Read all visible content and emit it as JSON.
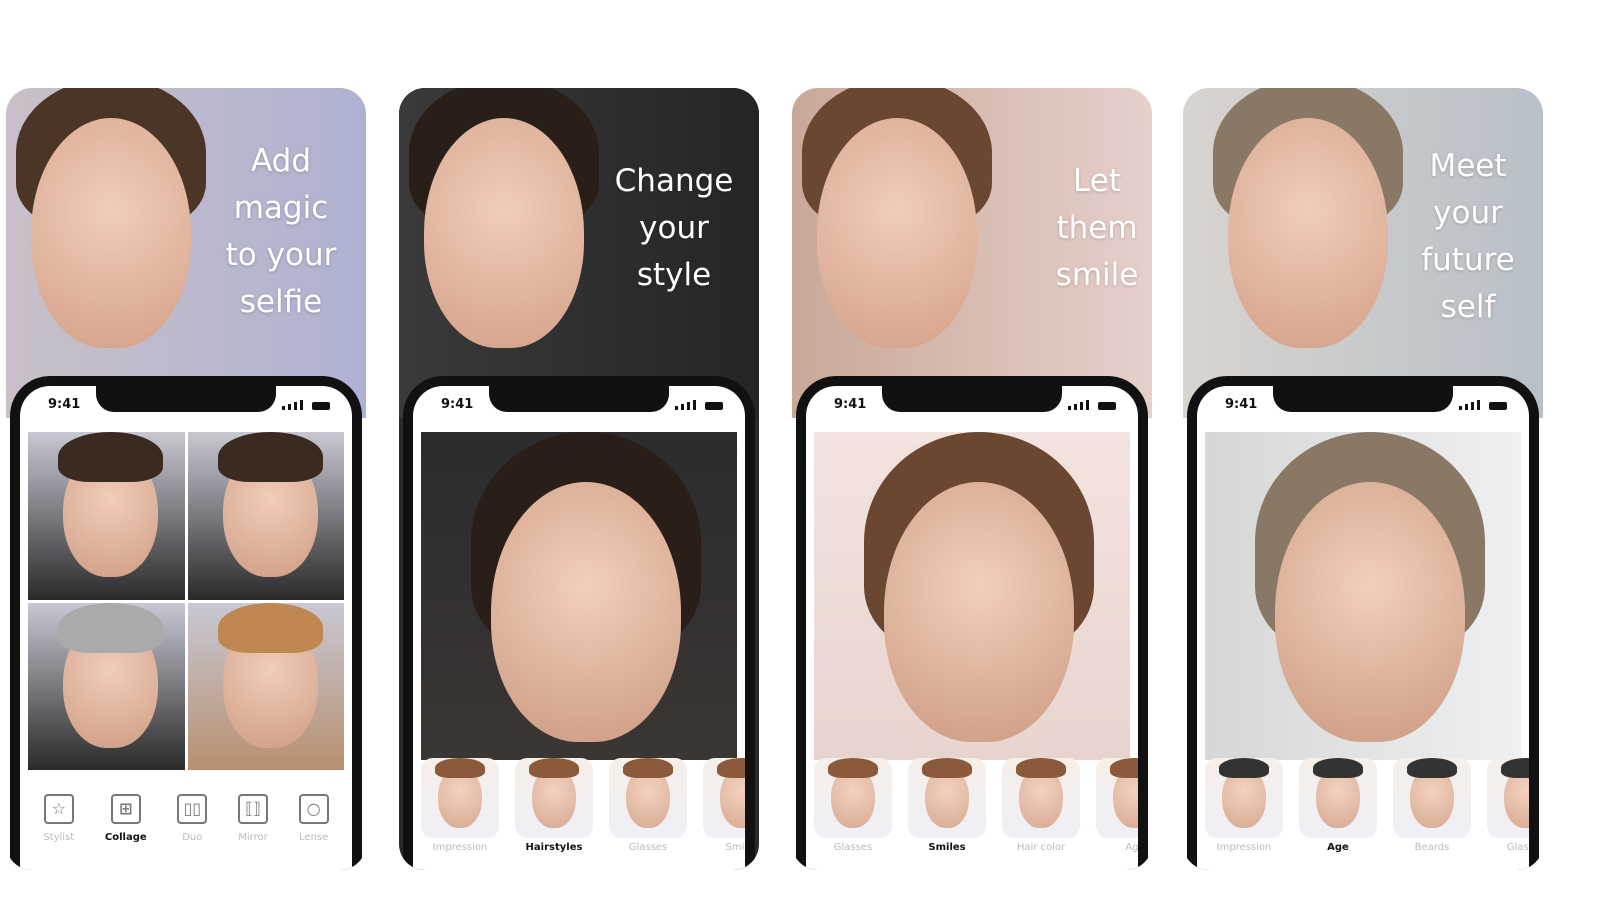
{
  "panels": [
    {
      "tagline": [
        "Add",
        "magic",
        "to your",
        "selfie"
      ],
      "time": "9:41",
      "toolbar": [
        {
          "label": "Stylist",
          "icon": "star-icon"
        },
        {
          "label": "Collage",
          "icon": "grid-icon",
          "selected": true
        },
        {
          "label": "Duo",
          "icon": "split-icon"
        },
        {
          "label": "Mirror",
          "icon": "mirror-icon"
        },
        {
          "label": "Lense",
          "icon": "lens-icon"
        }
      ]
    },
    {
      "tagline": [
        "Change",
        "your",
        "style"
      ],
      "time": "9:41",
      "filters": [
        {
          "label": "Impression"
        },
        {
          "label": "Hairstyles",
          "selected": true
        },
        {
          "label": "Glasses"
        },
        {
          "label": "Smiles"
        }
      ]
    },
    {
      "tagline": [
        "Let",
        "them",
        "smile"
      ],
      "time": "9:41",
      "filters": [
        {
          "label": "Glasses"
        },
        {
          "label": "Smiles",
          "selected": true
        },
        {
          "label": "Hair color"
        },
        {
          "label": "Age"
        }
      ]
    },
    {
      "tagline": [
        "Meet",
        "your",
        "future",
        "self"
      ],
      "time": "9:41",
      "filters": [
        {
          "label": "Impression"
        },
        {
          "label": "Age",
          "selected": true
        },
        {
          "label": "Beards"
        },
        {
          "label": "Glasses"
        }
      ]
    }
  ],
  "colors": {
    "panel1_bg": "#b9bdd6",
    "panel2_bg": "#2e2e2e",
    "panel3_bg": "#dcc4bd",
    "panel4_bg": "#c9cdd3",
    "skin": "#e4b8a0"
  }
}
